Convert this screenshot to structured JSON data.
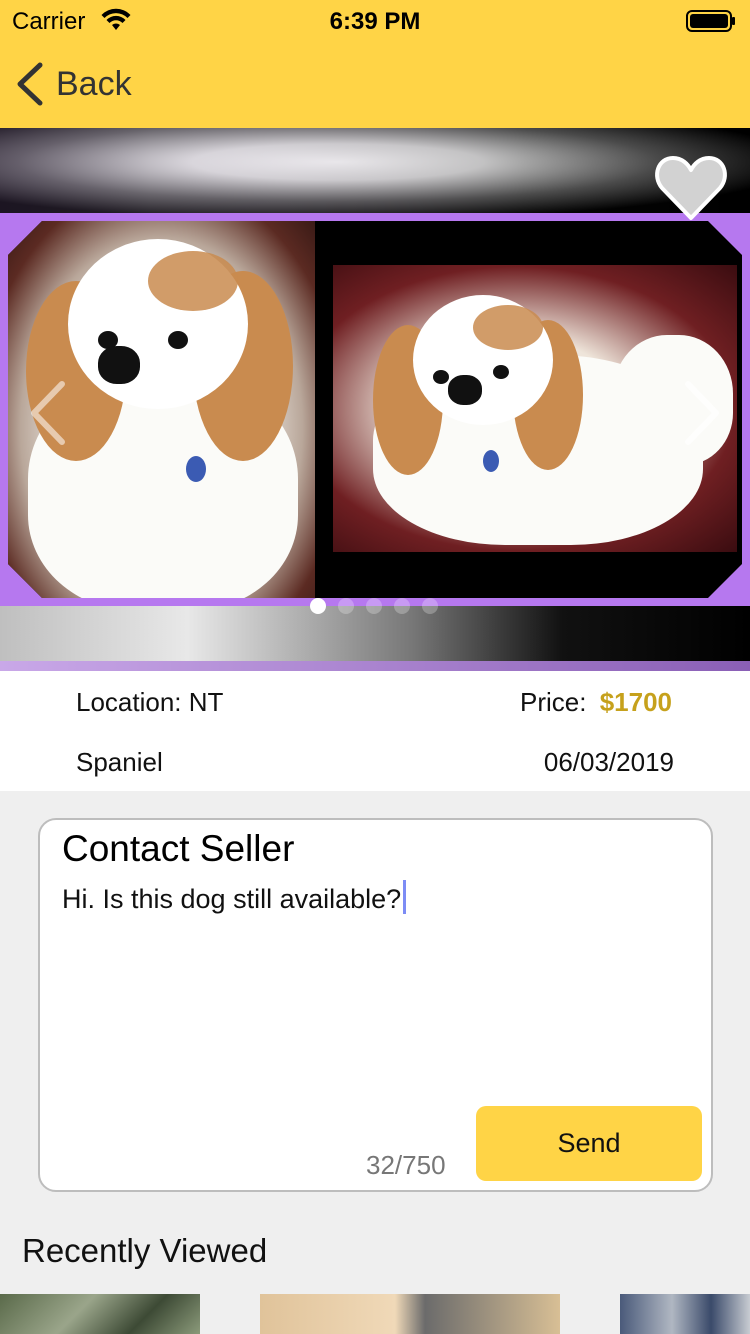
{
  "status_bar": {
    "carrier": "Carrier",
    "time": "6:39 PM"
  },
  "nav": {
    "back_label": "Back"
  },
  "gallery": {
    "page_count": 5,
    "current_page": 1,
    "favorite": false
  },
  "listing": {
    "location_label": "Location: NT",
    "price_label": "Price:",
    "price_value": "$1700",
    "breed": "Spaniel",
    "date": "06/03/2019"
  },
  "contact": {
    "title": "Contact Seller",
    "message": "Hi. Is this dog still available?",
    "char_count": "32/750",
    "send_label": "Send"
  },
  "recent": {
    "title": "Recently Viewed"
  },
  "colors": {
    "accent": "#ffd446",
    "price": "#c6a11c",
    "frame": "#b678ef"
  }
}
